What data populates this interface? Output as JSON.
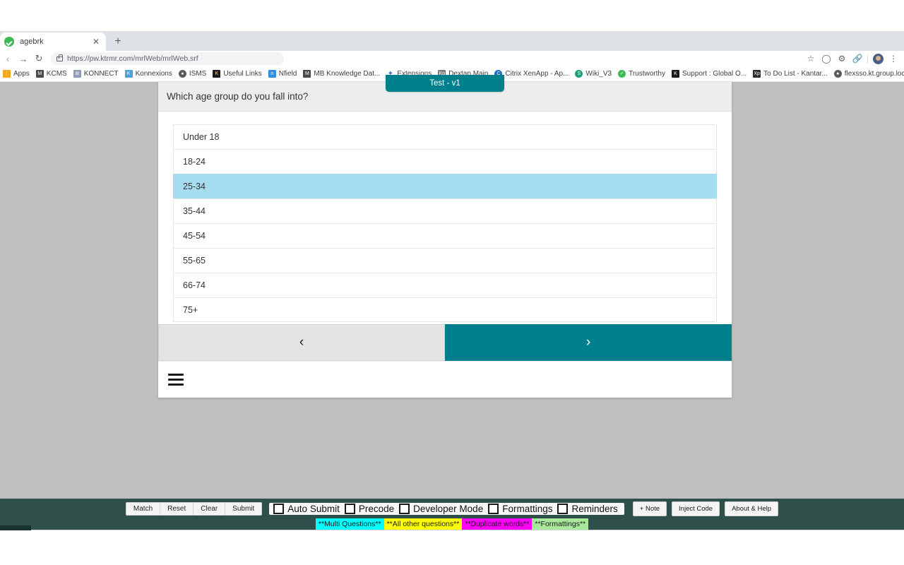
{
  "browser": {
    "tab": {
      "title": "agebrk",
      "favicon": "check-circle-icon",
      "close": "✕"
    },
    "newtab_label": "+",
    "window_controls": {
      "minimize": "minimize-icon",
      "maximize": "maximize-icon",
      "close": "✕"
    },
    "nav": {
      "back": "‹",
      "forward": "→",
      "reload": "↻"
    },
    "address": {
      "url": "https://pw.ktrmr.com/mrlWeb/mrlWeb.srf",
      "lock": "lock-icon"
    },
    "omni_icons": [
      "star-icon",
      "circle-icon",
      "gear-icon",
      "extension-icon",
      "avatar-icon",
      "menu-icon"
    ],
    "bookmarks": [
      {
        "label": "Apps",
        "color": "#f5a623",
        "glyph": "⋮"
      },
      {
        "label": "KCMS",
        "color": "#4a4a4a",
        "glyph": "M"
      },
      {
        "label": "KONNECT",
        "color": "#8e9bb3",
        "glyph": "⊞"
      },
      {
        "label": "Konnexions",
        "color": "#4aa3df",
        "glyph": "K"
      },
      {
        "label": "ISMS",
        "color": "#5a5a5a",
        "glyph": "●"
      },
      {
        "label": "Useful Links",
        "color": "#1a1a1a",
        "glyph": "K"
      },
      {
        "label": "Nfield",
        "color": "#2e8fe0",
        "glyph": "n"
      },
      {
        "label": "MB Knowledge Dat...",
        "color": "#4a4a4a",
        "glyph": "M"
      },
      {
        "label": "Extensions",
        "color": "#3d6fd1",
        "glyph": "✦"
      },
      {
        "label": "Dextap Main",
        "color": "#7a7a7a",
        "glyph": "Kp"
      },
      {
        "label": "Citrix XenApp - Ap...",
        "color": "#1b6ec2",
        "glyph": "C"
      },
      {
        "label": "Wiki_V3",
        "color": "#1b9e77",
        "glyph": "S"
      },
      {
        "label": "Trustworthy",
        "color": "#3cba54",
        "glyph": "✓"
      },
      {
        "label": "Support : Global O...",
        "color": "#1a1a1a",
        "glyph": "K"
      },
      {
        "label": "To Do List - Kantar...",
        "color": "#2b2b2b",
        "glyph": "Xp"
      },
      {
        "label": "flexsso.kt.group.loc...",
        "color": "#5a5a5a",
        "glyph": "●"
      }
    ],
    "bookmarks_overflow": "»"
  },
  "survey": {
    "version_badge": "Test - v1",
    "question": "Which age group do you fall into?",
    "options": [
      {
        "label": "Under 18",
        "selected": false
      },
      {
        "label": "18-24",
        "selected": false
      },
      {
        "label": "25-34",
        "selected": true
      },
      {
        "label": "35-44",
        "selected": false
      },
      {
        "label": "45-54",
        "selected": false
      },
      {
        "label": "55-65",
        "selected": false
      },
      {
        "label": "66-74",
        "selected": false
      },
      {
        "label": "75+",
        "selected": false
      }
    ],
    "nav": {
      "prev": "‹",
      "next": "›"
    },
    "menu_icon": "hamburger-menu-icon",
    "colors": {
      "accent_teal": "#00808c",
      "selected_blue": "#a6dcef",
      "header_grey": "#eceeed"
    }
  },
  "devbar": {
    "action_buttons": [
      "Match",
      "Reset",
      "Clear",
      "Submit"
    ],
    "checkboxes": [
      {
        "label": "Auto Submit",
        "checked": false
      },
      {
        "label": "Precode",
        "checked": false
      },
      {
        "label": "Developer Mode",
        "checked": false
      },
      {
        "label": "Formattings",
        "checked": false
      },
      {
        "label": "Reminders",
        "checked": false
      }
    ],
    "right_buttons": [
      "+ Note",
      "Inject Code",
      "About & Help"
    ],
    "legend": [
      {
        "text": "**Multi Questions**",
        "color": "#00ffff"
      },
      {
        "text": "**All other questions**",
        "color": "#ffff00"
      },
      {
        "text": "**Duplicate words**",
        "color": "#ff00ff"
      },
      {
        "text": "**Formattings**",
        "color": "#a9e89b"
      }
    ],
    "bar_color": "#2f4f4a"
  }
}
